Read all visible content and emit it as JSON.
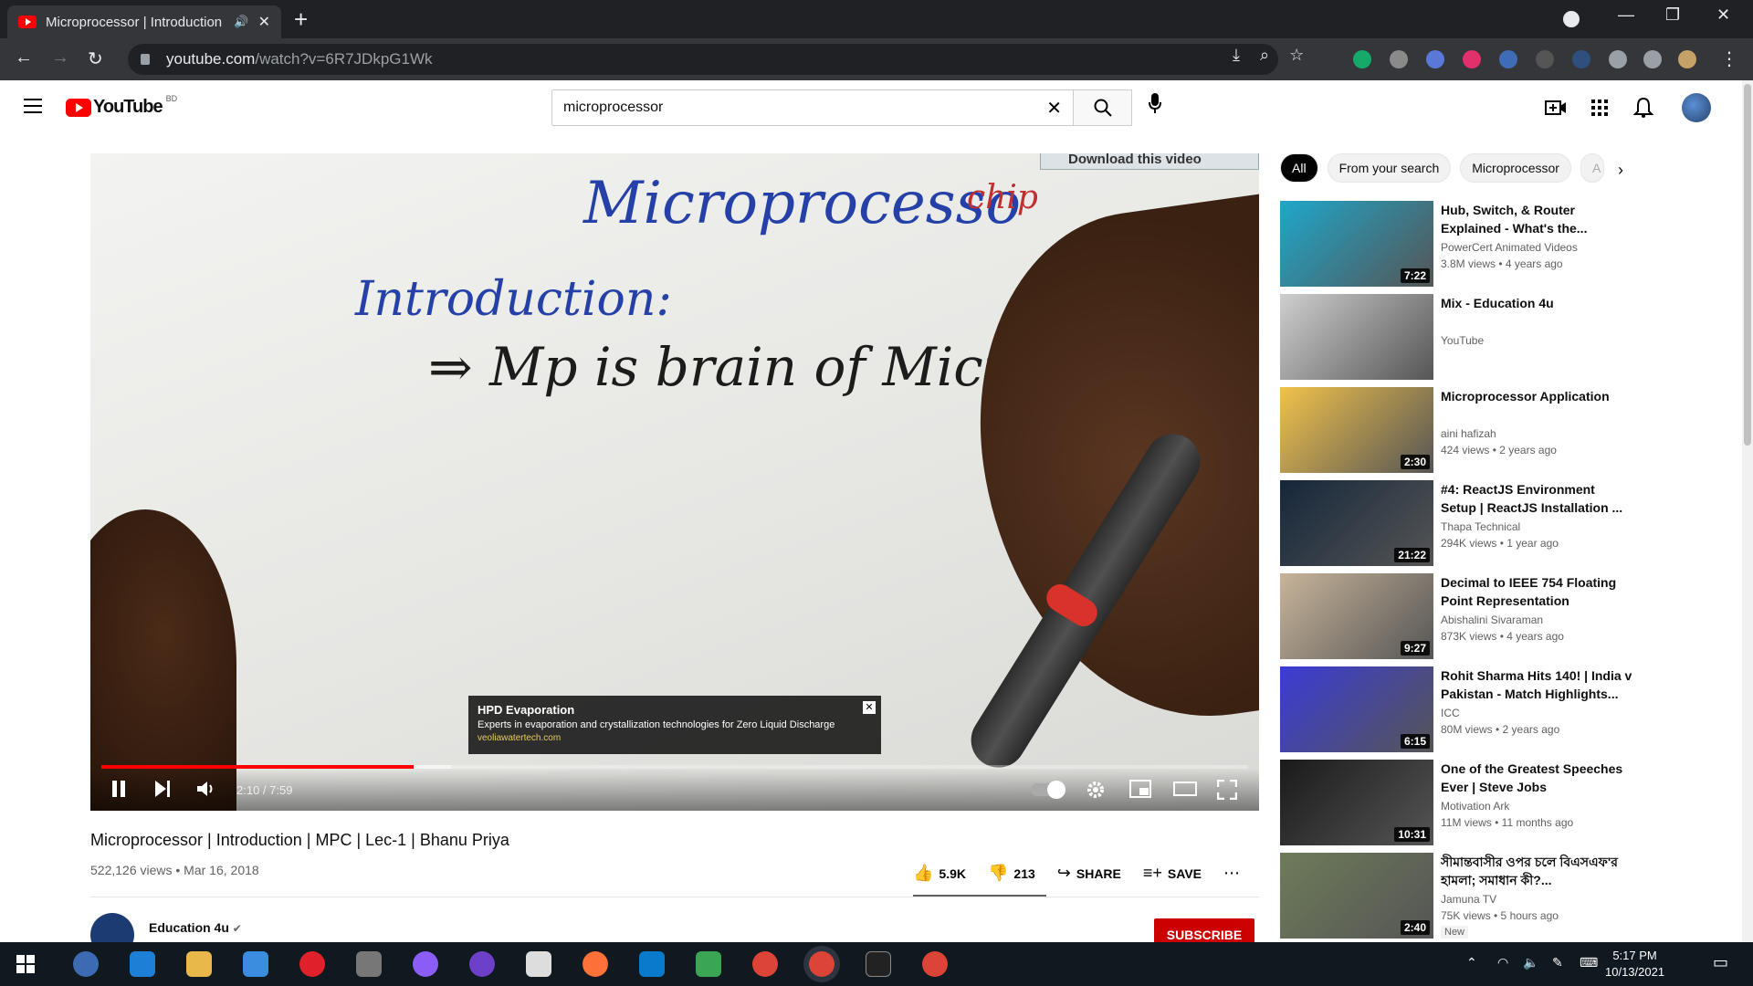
{
  "browser": {
    "tab_title": "Microprocessor | Introduction",
    "url_host": "youtube.com",
    "url_path": "/watch?v=6R7JDkpG1Wk"
  },
  "youtube": {
    "logo_text": "YouTube",
    "country_code": "BD",
    "search_value": "microprocessor"
  },
  "player": {
    "board_title": "Microprocesso",
    "board_chip": "chip",
    "board_intro": "Introduction:",
    "board_line": "⇒ Mp  is brain of Micro Com",
    "download_banner": "Download this video",
    "time": "2:10 / 7:59",
    "progress_played": 0.272,
    "progress_buffered": 0.305,
    "ad": {
      "title": "HPD Evaporation",
      "desc": "Experts in evaporation and crystallization technologies for Zero Liquid Discharge",
      "url": "veoliawatertech.com"
    }
  },
  "video": {
    "title": "Microprocessor | Introduction | MPC | Lec-1 | Bhanu Priya",
    "meta": "522,126 views • Mar 16, 2018",
    "likes": "5.9K",
    "dislikes": "213",
    "share_label": "SHARE",
    "save_label": "SAVE",
    "channel": "Education 4u",
    "subscribe_label": "SUBSCRIBE"
  },
  "chips": [
    "All",
    "From your search",
    "Microprocessor",
    "A"
  ],
  "recommendations": [
    {
      "title": "Hub, Switch, & Router Explained - What's the...",
      "channel": "PowerCert Animated Videos",
      "meta": "3.8M views • 4 years ago",
      "duration": "7:22",
      "thumb_color": "#1fa7c9"
    },
    {
      "title": "Mix - Education 4u",
      "channel": "YouTube",
      "meta": "",
      "duration": "",
      "thumb_color": "#cfcfcf"
    },
    {
      "title": "Microprocessor Application",
      "channel": "aini hafizah",
      "meta": "424 views • 2 years ago",
      "duration": "2:30",
      "thumb_color": "#f0c24b"
    },
    {
      "title": "#4: ReactJS Environment Setup | ReactJS Installation ...",
      "channel": "Thapa Technical",
      "meta": "294K views • 1 year ago",
      "duration": "21:22",
      "thumb_color": "#16273a"
    },
    {
      "title": "Decimal to IEEE 754 Floating Point Representation",
      "channel": "Abishalini Sivaraman",
      "meta": "873K views • 4 years ago",
      "duration": "9:27",
      "thumb_color": "#c7b49a"
    },
    {
      "title": "Rohit Sharma Hits 140! | India v Pakistan - Match Highlights...",
      "channel": "ICC",
      "meta": "80M views • 2 years ago",
      "duration": "6:15",
      "thumb_color": "#3b3bd6"
    },
    {
      "title": "One of the Greatest Speeches Ever | Steve Jobs",
      "channel": "Motivation Ark",
      "meta": "11M views • 11 months ago",
      "duration": "10:31",
      "thumb_color": "#1a1a1a"
    },
    {
      "title": "সীমান্তবাসীর ওপর চলে বিএসএফ'র হামলা; সমাধান কী?...",
      "channel": "Jamuna TV",
      "meta": "75K views • 5 hours ago",
      "duration": "2:40",
      "thumb_color": "#6e7b5a",
      "badge": "New"
    }
  ],
  "clock": {
    "time": "5:17 PM",
    "date": "10/13/2021"
  }
}
